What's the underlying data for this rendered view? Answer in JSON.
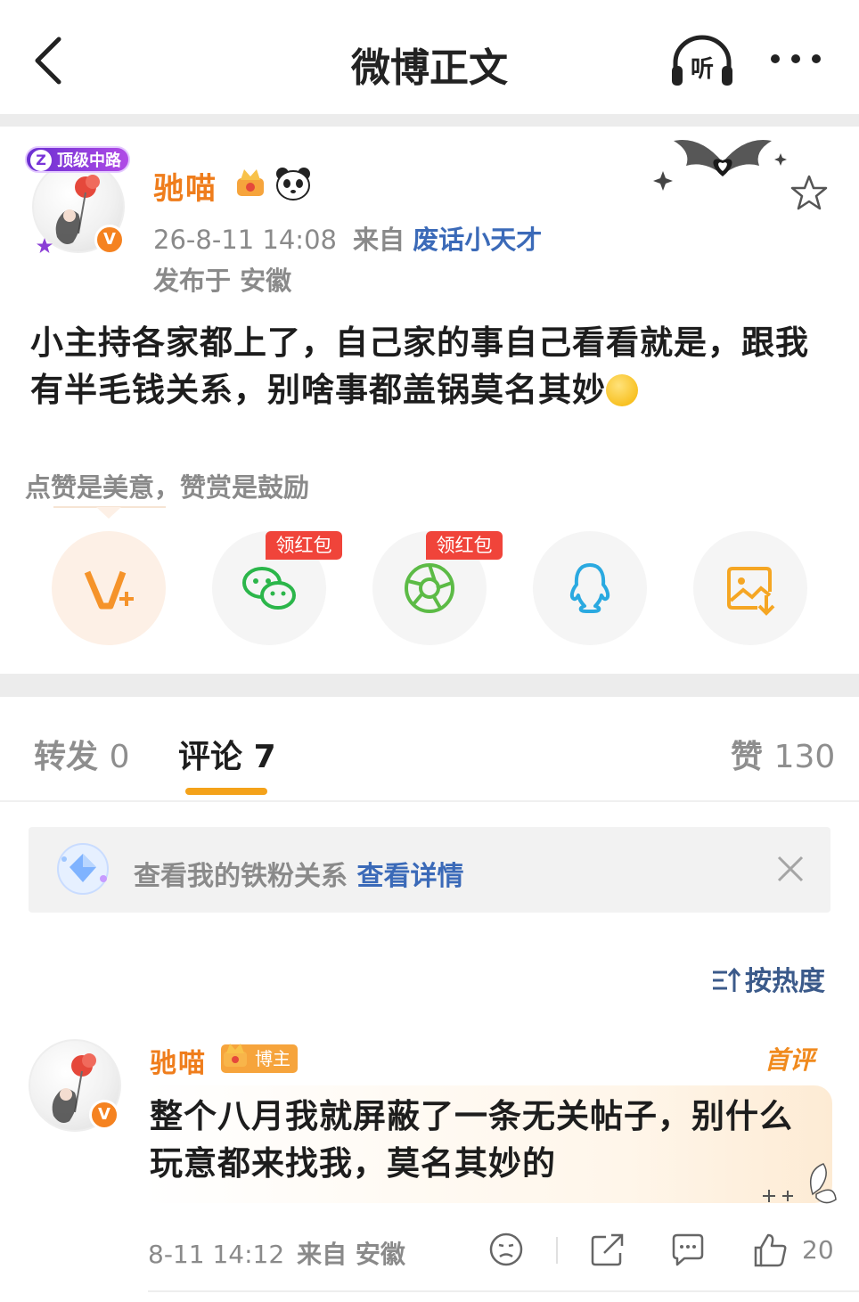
{
  "header": {
    "title": "微博正文",
    "listen_label": "听"
  },
  "post": {
    "badge": "顶级中路",
    "badge_icon": "Z",
    "verified_mark": "V",
    "username": "驰喵",
    "timestamp": "26-8-11 14:08",
    "source_label": "来自",
    "source": "废话小天才",
    "location": "发布于 安徽",
    "text": "小主持各家都上了，自己家的事自己看看就是，跟我有半毛钱关系，别啥事都盖锅莫名其妙"
  },
  "reward": {
    "tip": "点赞是美意，赞赏是鼓励"
  },
  "share": {
    "items": [
      {
        "icon": "v-plus-icon"
      },
      {
        "icon": "wechat-icon",
        "tag": "领红包"
      },
      {
        "icon": "moments-icon",
        "tag": "领红包"
      },
      {
        "icon": "qq-icon"
      },
      {
        "icon": "save-image-icon"
      }
    ]
  },
  "tabs": {
    "repost": {
      "label": "转发",
      "count": "0"
    },
    "comments": {
      "label": "评论",
      "count": "7"
    },
    "likes": {
      "label": "赞",
      "count": "130"
    }
  },
  "fan_banner": {
    "text": "查看我的铁粉关系",
    "link": "查看详情"
  },
  "sort": {
    "label": "按热度"
  },
  "comment": {
    "username": "驰喵",
    "host_tag": "博主",
    "first_tag": "首评",
    "verified_mark": "V",
    "text": "整个八月我就屏蔽了一条无关帖子，别什么玩意都来找我，莫名其妙的",
    "time": "8-11 14:12",
    "location": "来自 安徽",
    "likes": "20"
  },
  "colors": {
    "accent_orange": "#ef7d1c",
    "link_blue": "#3b6ab8",
    "tab_underline": "#f4a21a",
    "red_packet": "#f0443a"
  }
}
